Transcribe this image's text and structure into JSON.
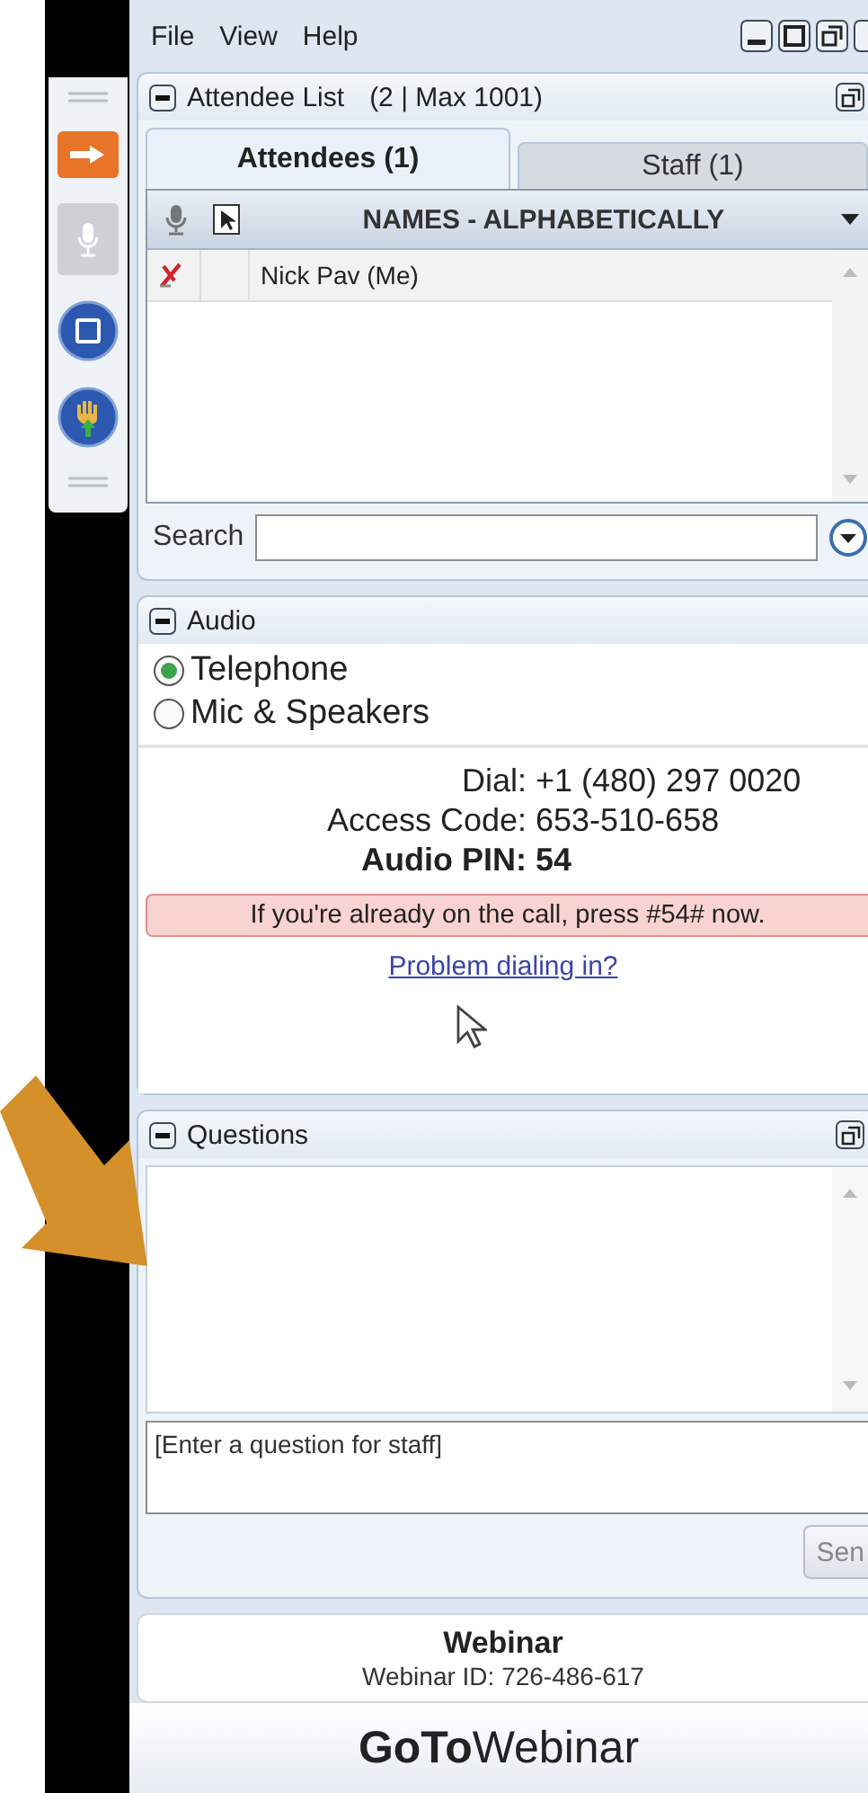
{
  "menu": [
    "File",
    "View",
    "Help"
  ],
  "attendee_panel": {
    "title": "Attendee List",
    "count": "(2 | Max 1001)",
    "tabs": [
      {
        "label": "Attendees (1)",
        "selected": true
      },
      {
        "label": "Staff (1)",
        "selected": false
      }
    ],
    "column_header": "NAMES - ALPHABETICALLY",
    "rows": [
      {
        "name": "Nick Pav (Me)"
      }
    ],
    "search_label": "Search"
  },
  "audio": {
    "title": "Audio",
    "options": [
      {
        "label": "Telephone",
        "selected": true
      },
      {
        "label": "Mic & Speakers",
        "selected": false
      }
    ],
    "details": [
      {
        "label": "Dial:",
        "value": "+1 (480) 297 0020",
        "emphasis": false
      },
      {
        "label": "Access Code:",
        "value": "653-510-658",
        "emphasis": false
      },
      {
        "label": "Audio PIN:",
        "value": "54",
        "emphasis": true
      }
    ],
    "notice": "If you're already on the call, press #54# now.",
    "link": "Problem dialing in?"
  },
  "questions": {
    "title": "Questions",
    "placeholder": "[Enter a question for staff]",
    "send": "Sen"
  },
  "footer": {
    "title": "Webinar",
    "webinar_id": "Webinar ID: 726-486-617",
    "logo": "**GoTo**Webinar"
  }
}
